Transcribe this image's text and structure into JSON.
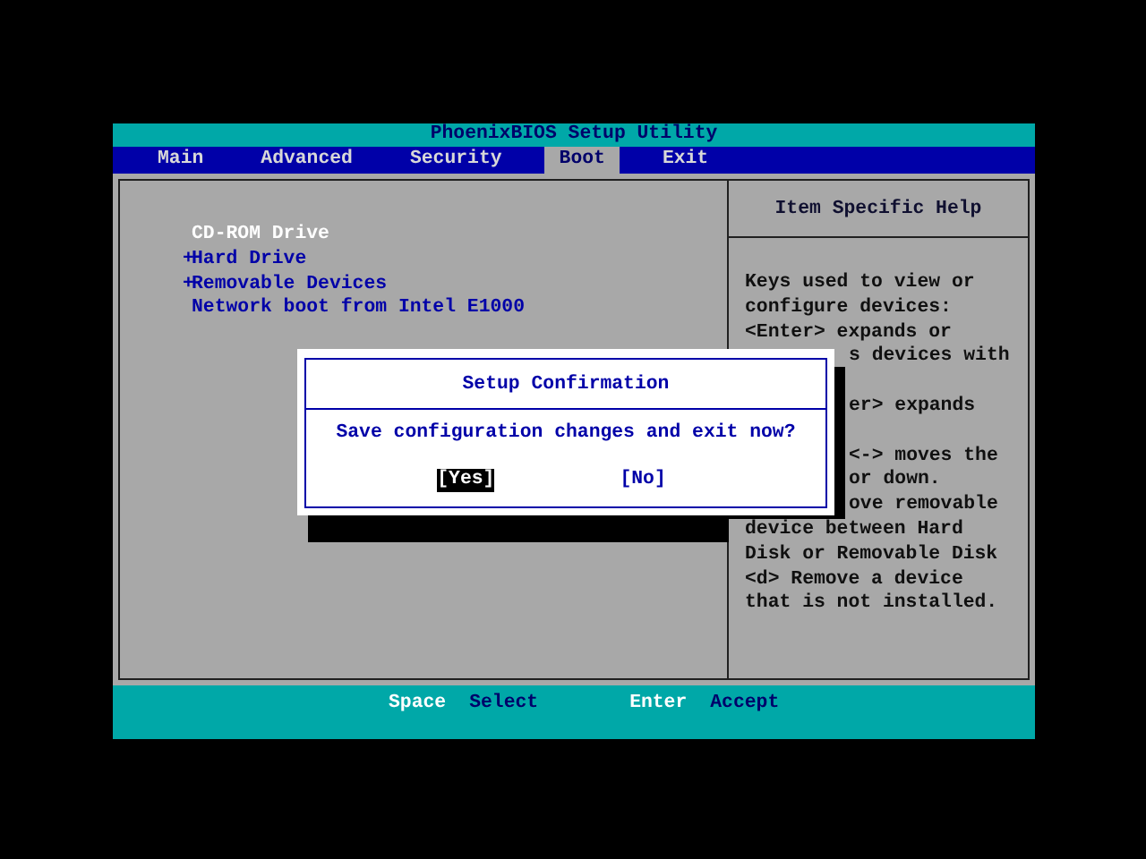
{
  "window": {
    "title": "PhoenixBIOS Setup Utility"
  },
  "tabs": [
    {
      "label": "Main",
      "selected": false
    },
    {
      "label": "Advanced",
      "selected": false
    },
    {
      "label": "Security",
      "selected": false
    },
    {
      "label": "Boot",
      "selected": true
    },
    {
      "label": "Exit",
      "selected": false
    }
  ],
  "boot_items": [
    {
      "marker": "",
      "label": "CD-ROM Drive",
      "selected": true
    },
    {
      "marker": "+",
      "label": "Hard Drive",
      "selected": false
    },
    {
      "marker": "+",
      "label": "Removable Devices",
      "selected": false
    },
    {
      "marker": "",
      "label": "Network boot from Intel E1000",
      "selected": false
    }
  ],
  "help": {
    "title": "Item Specific Help",
    "lines": [
      {
        "kind": "full",
        "text": "Keys used to view or"
      },
      {
        "kind": "full",
        "text": "configure devices:"
      },
      {
        "kind": "full",
        "text": "<Enter> expands or"
      },
      {
        "kind": "partial",
        "text": "s devices with"
      },
      {
        "kind": "covered"
      },
      {
        "kind": "partial",
        "text": "er> expands"
      },
      {
        "kind": "covered"
      },
      {
        "kind": "partial",
        "text": "<-> moves the"
      },
      {
        "kind": "partial",
        "text": "or down."
      },
      {
        "kind": "partial",
        "text": "ove removable"
      },
      {
        "kind": "full",
        "text": "device between Hard"
      },
      {
        "kind": "full",
        "text": "Disk or Removable Disk"
      },
      {
        "kind": "full",
        "text": "<d> Remove a device"
      },
      {
        "kind": "full",
        "text": "that is not installed."
      }
    ]
  },
  "dialog": {
    "title": "Setup Confirmation",
    "message": "Save configuration changes and exit now?",
    "buttons": [
      {
        "label": "[Yes]",
        "selected": true
      },
      {
        "label": "[No]",
        "selected": false
      }
    ]
  },
  "status_bar": [
    {
      "key": "Space",
      "action": "Select"
    },
    {
      "key": "Enter",
      "action": "Accept"
    }
  ]
}
